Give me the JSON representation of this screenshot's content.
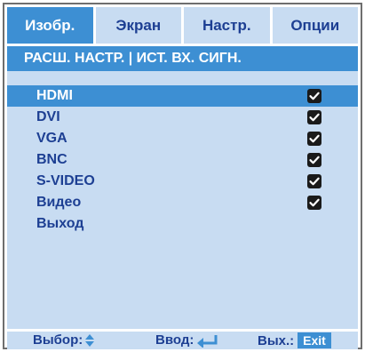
{
  "tabs": [
    {
      "label": "Изобр.",
      "active": true
    },
    {
      "label": "Экран",
      "active": false
    },
    {
      "label": "Настр.",
      "active": false
    },
    {
      "label": "Опции",
      "active": false
    }
  ],
  "breadcrumb": "РАСШ. НАСТР. | ИСТ. ВХ. СИГН.",
  "sources": [
    {
      "label": "HDMI",
      "checked": true,
      "selected": true
    },
    {
      "label": "DVI",
      "checked": true,
      "selected": false
    },
    {
      "label": "VGA",
      "checked": true,
      "selected": false
    },
    {
      "label": "BNC",
      "checked": true,
      "selected": false
    },
    {
      "label": "S-VIDEO",
      "checked": true,
      "selected": false
    },
    {
      "label": "Видео",
      "checked": true,
      "selected": false
    }
  ],
  "exit_item": "Выход",
  "footer": {
    "select_label": "Выбор:",
    "enter_label": "Ввод:",
    "back_label": "Вых.:",
    "exit_badge": "Exit"
  },
  "colors": {
    "accent": "#3d8fd3",
    "panel": "#c8dcf2",
    "text": "#1d3f93"
  }
}
